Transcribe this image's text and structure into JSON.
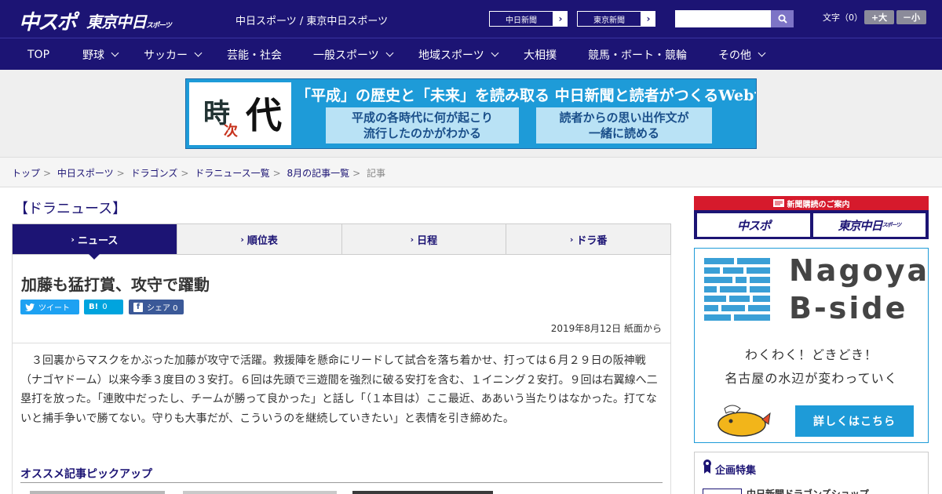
{
  "header": {
    "logo_chuspo": "中スポ",
    "logo_tokyo": "東京中日",
    "logo_tokyo_small": "スポーツ",
    "site_names": "中日スポーツ / 東京中日スポーツ",
    "paper_buttons": [
      {
        "label": "中日新聞",
        "arrow": "›"
      },
      {
        "label": "東京新聞",
        "arrow": "›"
      }
    ],
    "search": {
      "placeholder": "",
      "icon": "search-icon"
    },
    "font_size": {
      "label": "文字（0）",
      "larger": "+大",
      "smaller": "－小"
    }
  },
  "nav": {
    "items": [
      {
        "label": "TOP",
        "dropdown": false
      },
      {
        "label": "野球",
        "dropdown": true
      },
      {
        "label": "サッカー",
        "dropdown": true
      },
      {
        "label": "芸能・社会",
        "dropdown": false
      },
      {
        "label": "一般スポーツ",
        "dropdown": true
      },
      {
        "label": "地域スポーツ",
        "dropdown": true
      },
      {
        "label": "大相撲",
        "dropdown": false
      },
      {
        "label": "競馬・ボート・競輪",
        "dropdown": false
      },
      {
        "label": "その他",
        "dropdown": true
      }
    ]
  },
  "banner": {
    "toki": "時",
    "ji": "次",
    "dai": "代",
    "title": "「平成」の歴史と「未来」を読み取る 中日新聞と読者がつくるWebサイト",
    "card_left": [
      "平成の各時代に何が起こり",
      "流行したのかがわかる"
    ],
    "card_right": [
      "読者からの思い出作文が",
      "一緒に読める"
    ]
  },
  "breadcrumb": {
    "links": [
      "トップ",
      "中日スポーツ",
      "ドラゴンズ",
      "ドラニュース一覧",
      "8月の記事一覧"
    ],
    "current": "記事",
    "separator": ">"
  },
  "main": {
    "section_title": "【ドラニュース】",
    "tabs": [
      {
        "label": "ニュース",
        "active": true
      },
      {
        "label": "順位表",
        "active": false
      },
      {
        "label": "日程",
        "active": false
      },
      {
        "label": "ドラ番",
        "active": false
      }
    ],
    "tab_caret": "›",
    "article": {
      "title": "加藤も猛打賞、攻守で躍動",
      "share": {
        "tweet": "ツイート",
        "hatena_icon": "B!",
        "hatena_count": "0",
        "facebook_icon": "f",
        "facebook_label": "シェア 0"
      },
      "date": "2019年8月12日 紙面から",
      "body": "　３回裏からマスクをかぶった加藤が攻守で活躍。救援陣を懸命にリードして試合を落ち着かせ、打っては６月２９日の阪神戦（ナゴヤドーム）以来今季３度目の３安打。６回は先頭で三遊間を強烈に破る安打を含む、１イニング２安打。９回は右翼線へ二塁打を放った。「連敗中だったし、チームが勝って良かった」と話し「（１本目は）ここ最近、ああいう当たりはなかった。打てないと捕手争いで勝てない。守りも大事だが、こういうのを継続していきたい」と表情を引き締めた。"
    },
    "pickup_title": "オススメ記事ピックアップ"
  },
  "sidebar": {
    "subscribe": {
      "head": "新聞購読のご案内",
      "logo_left": "中スポ",
      "logo_right": "東京中日",
      "logo_right_small": "スポーツ"
    },
    "bside": {
      "word1": "Nagoya",
      "word2": "B-side",
      "line1": "わくわく！どきどき！",
      "line2": "名古屋の水辺が変わっていく",
      "button": "詳しくはこちら"
    },
    "feature": {
      "title": "企画特集",
      "item": "中日新聞ドラゴンズショップ"
    }
  },
  "colors": {
    "navy": "#1c1474",
    "accent_blue": "#1e9bd8",
    "red": "#d61a2c",
    "twitter": "#1da1f2",
    "hatena": "#00a4de",
    "facebook": "#3b5998"
  }
}
